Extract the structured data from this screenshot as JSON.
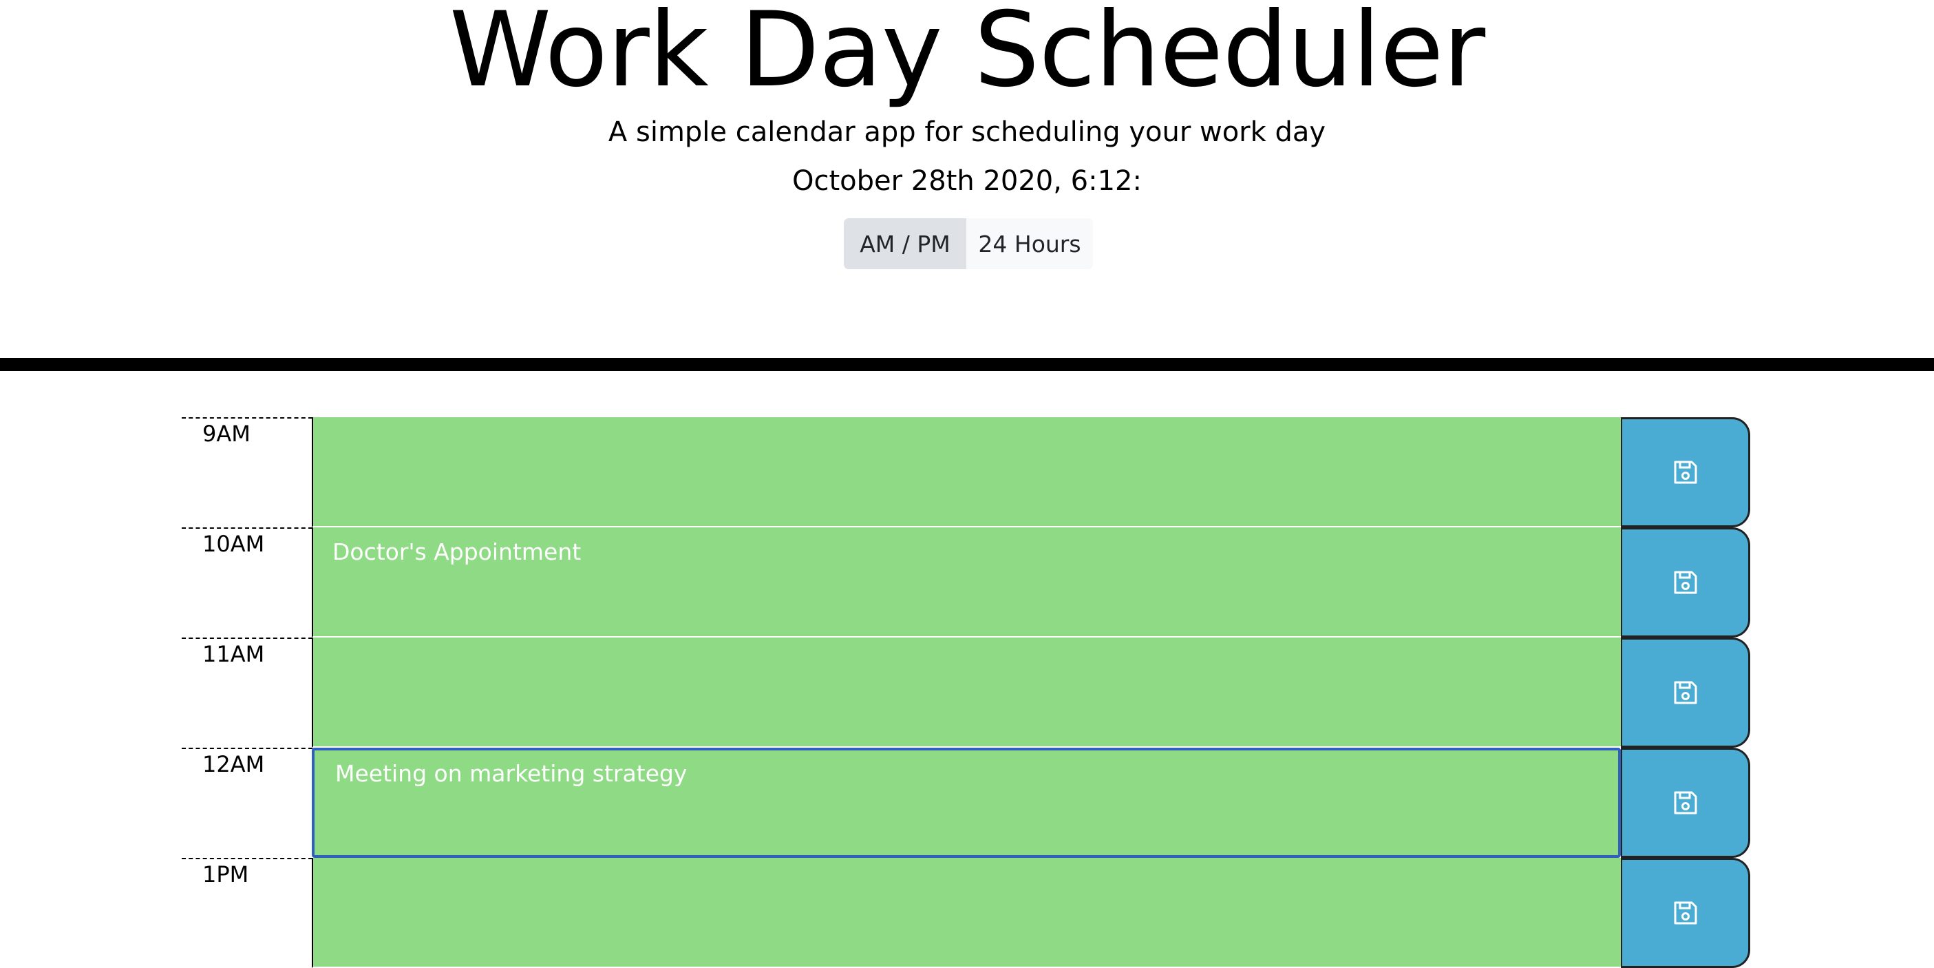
{
  "header": {
    "title": "Work Day Scheduler",
    "subtitle": "A simple calendar app for scheduling your work day",
    "datetime": "October 28th 2020, 6:12:"
  },
  "format_toggle": {
    "options": [
      "AM / PM",
      "24 Hours"
    ],
    "selected": "AM / PM"
  },
  "schedule": {
    "rows": [
      {
        "hour": "9AM",
        "event": ""
      },
      {
        "hour": "10AM",
        "event": "Doctor's Appointment"
      },
      {
        "hour": "11AM",
        "event": ""
      },
      {
        "hour": "12AM",
        "event": "Meeting on marketing strategy"
      },
      {
        "hour": "1PM",
        "event": ""
      }
    ],
    "save_icon": "floppy-disk-icon"
  },
  "colors": {
    "present_block": "#8fdb85",
    "save_button": "#4bacd3",
    "toggle_active": "#dee2e6",
    "toggle_inactive": "#f8f9fa",
    "focus_border": "#2f5fbf"
  }
}
